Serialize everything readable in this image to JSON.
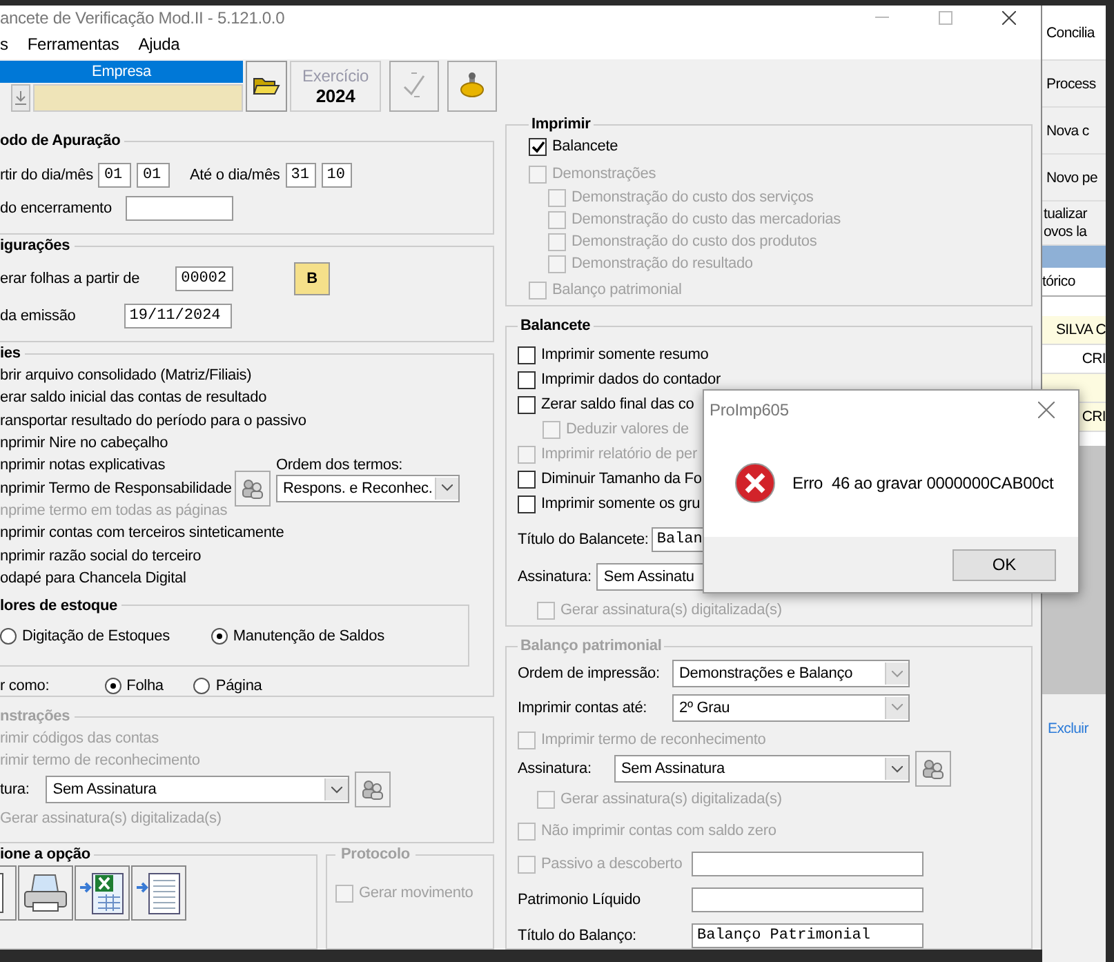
{
  "window": {
    "title": "ancete de Verificação Mod.II - 5.121.0.0"
  },
  "menu": [
    "s",
    "Ferramentas",
    "Ajuda"
  ],
  "toolbar": {
    "company_header": "Empresa",
    "exercise_label": "Exercício",
    "exercise_year": "2024"
  },
  "periodo": {
    "title": "odo de Apuração",
    "from_label": "rtir do dia/mês",
    "from_day": "01",
    "from_month": "01",
    "to_label": "Até o dia/mês",
    "to_day": "31",
    "to_month": "10",
    "closing_label": "do encerramento"
  },
  "config": {
    "title": "igurações",
    "pages_label": "erar folhas a partir de",
    "pages_value": "00002",
    "b_button": "B",
    "date_label": "da emissão",
    "date_value": "19/11/2024"
  },
  "options": {
    "title": "ies",
    "items": [
      {
        "label": "brir arquivo consolidado (Matriz/Filiais)",
        "disabled": false
      },
      {
        "label": "erar saldo inicial das contas de resultado",
        "disabled": false
      },
      {
        "label": "ransportar resultado do período para o passivo",
        "disabled": false
      },
      {
        "label": "nprimir Nire no cabeçalho",
        "disabled": false
      },
      {
        "label": "nprimir notas explicativas",
        "disabled": false
      },
      {
        "label": "nprimir Termo de Responsabilidade",
        "disabled": false
      },
      {
        "label": "nprime termo em todas as páginas",
        "disabled": true
      },
      {
        "label": "nprimir contas com terceiros sinteticamente",
        "disabled": false
      },
      {
        "label": "nprimir razão social do terceiro",
        "disabled": false
      },
      {
        "label": "odapé para Chancela Digital",
        "disabled": false
      }
    ],
    "order_label": "Ordem dos termos:",
    "order_value": "Respons. e Reconhec.",
    "stock": {
      "title": "lores de estoque",
      "options": [
        {
          "label": "Digitação de Estoques",
          "selected": false
        },
        {
          "label": "Manutenção de Saldos",
          "selected": true
        }
      ]
    },
    "print_as_label": "r como:",
    "print_as": [
      {
        "label": "Folha",
        "selected": true
      },
      {
        "label": "Página",
        "selected": false
      }
    ]
  },
  "demonstracoes": {
    "title": "nstrações",
    "items": [
      {
        "label": "rimir códigos das contas",
        "disabled": true
      },
      {
        "label": "rimir termo de reconhecimento",
        "disabled": true
      }
    ],
    "signature_label": "tura:",
    "signature_value": "Sem Assinatura",
    "generate_label": "Gerar assinatura(s) digitalizada(s)"
  },
  "output": {
    "title": "ione a opção"
  },
  "protocolo": {
    "title": "Protocolo",
    "label": "Gerar movimento",
    "checked": false,
    "disabled": true
  },
  "imprimir": {
    "title": "Imprimir",
    "items": [
      {
        "label": "Balancete",
        "checked": true,
        "disabled": false
      },
      {
        "label": "Demonstrações",
        "checked": false,
        "disabled": true,
        "children": [
          {
            "label": "Demonstração do custo dos serviços",
            "checked": false,
            "disabled": true
          },
          {
            "label": "Demonstração do custo das mercadorias",
            "checked": false,
            "disabled": true
          },
          {
            "label": "Demonstração do custo dos produtos",
            "checked": false,
            "disabled": true
          },
          {
            "label": "Demonstração do resultado",
            "checked": false,
            "disabled": true
          }
        ]
      },
      {
        "label": "Balanço patrimonial",
        "checked": false,
        "disabled": true
      }
    ]
  },
  "balancete": {
    "title": "Balancete",
    "items": [
      {
        "label": "Imprimir somente resumo",
        "checked": false,
        "disabled": false
      },
      {
        "label": "Imprimir dados do contador",
        "checked": false,
        "disabled": false
      },
      {
        "label": "Zerar saldo final das co",
        "checked": false,
        "disabled": false,
        "children": [
          {
            "label": "Deduzir valores de",
            "checked": false,
            "disabled": true
          }
        ]
      },
      {
        "label": "Imprimir relatório de per",
        "checked": false,
        "disabled": true
      },
      {
        "label": "Diminuir Tamanho da Fo",
        "checked": false,
        "disabled": false
      },
      {
        "label": "Imprimir somente os gru",
        "checked": false,
        "disabled": false
      }
    ],
    "title_label": "Título do Balancete:",
    "title_value": "Balan",
    "signature_label": "Assinatura:",
    "signature_value": "Sem Assinatu",
    "generate": {
      "label": "Gerar assinatura(s) digitalizada(s)",
      "checked": false,
      "disabled": true
    }
  },
  "balanco": {
    "title": "Balanço patrimonial",
    "order_label": "Ordem de impressão:",
    "order_value": "Demonstrações e Balanço",
    "accounts_label": "Imprimir contas até:",
    "accounts_value": "2º Grau",
    "term": {
      "label": "Imprimir termo de reconhecimento",
      "checked": false,
      "disabled": true
    },
    "signature_label": "Assinatura:",
    "signature_value": "Sem Assinatura",
    "generate": {
      "label": "Gerar assinatura(s) digitalizada(s)",
      "checked": false,
      "disabled": true
    },
    "zero": {
      "label": "Não imprimir contas com saldo zero",
      "checked": false,
      "disabled": true
    },
    "passive": {
      "label": "Passivo a descoberto",
      "checked": false,
      "disabled": true
    },
    "equity_label": "Patrimonio Líquido",
    "title_label": "Título do Balanço:",
    "title_value": "Balanço Patrimonial"
  },
  "dialog": {
    "title": "ProImp605",
    "message": "Erro  46 ao gravar 0000000CAB00ct",
    "button": "OK"
  },
  "background_app": {
    "buttons": [
      "Concilia",
      "Process",
      "Nova c",
      "Novo pe"
    ],
    "note_lines": [
      "tualizar",
      "ovos la"
    ],
    "column": "tórico",
    "rows": [
      "SILVA C",
      "CRI",
      "",
      "CRI"
    ],
    "link": "Excluir"
  }
}
